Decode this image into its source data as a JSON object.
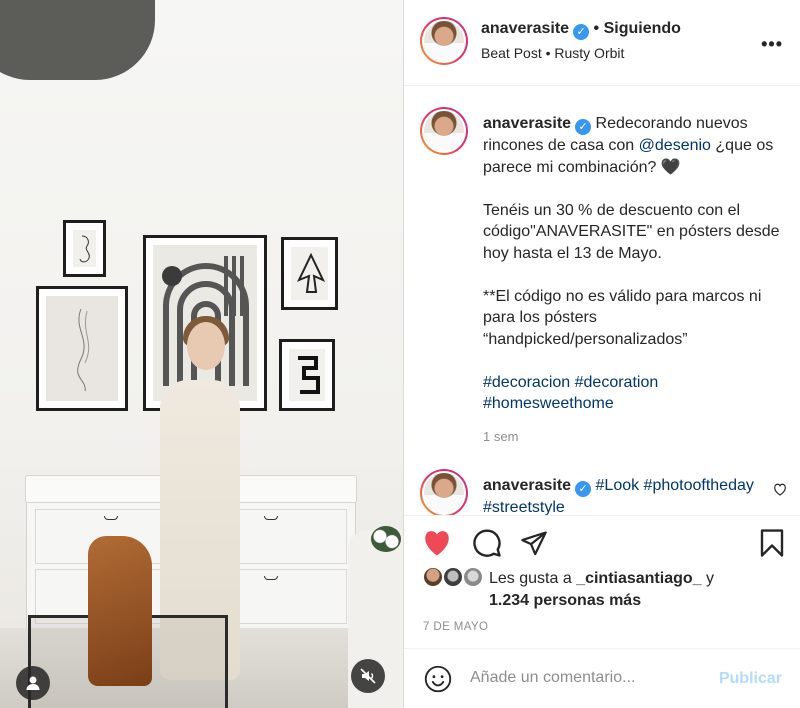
{
  "header": {
    "username": "anaverasite",
    "separator": "•",
    "follow_status": "Siguiendo",
    "audio_line": "Beat Post • Rusty Orbit",
    "more_icon": "more-horizontal-icon"
  },
  "caption": {
    "username": "anaverasite",
    "line1_pre": "Redecorando nuevos rincones de casa con ",
    "mention": "@desenio",
    "line1_post": " ¿que os parece mi combinación? 🖤",
    "para2": "Tenéis un 30 % de descuento con el código\"ANAVERASITE\" en pósters desde hoy hasta el 13 de Mayo.",
    "para3": "**El código no es válido para marcos ni para los pósters “handpicked/personalizados”",
    "hashtags": "#decoracion #decoration #homesweethome",
    "time": "1 sem"
  },
  "comment2": {
    "username": "anaverasite",
    "text": "#Look #photooftheday #streetstyle"
  },
  "actions": {
    "like_icon": "heart-filled-icon",
    "comment_icon": "comment-icon",
    "share_icon": "paper-plane-icon",
    "save_icon": "bookmark-icon",
    "likes_prefix": "Les gusta a ",
    "likes_user": "_cintiasantiago_",
    "likes_and": " y",
    "likes_count": "1.234 personas más",
    "date": "7 DE MAYO"
  },
  "comment_box": {
    "emoji_icon": "smiley-icon",
    "placeholder": "Añade un comentario...",
    "post_label": "Publicar"
  },
  "media": {
    "user_tag_icon": "user-tag-icon",
    "mute_icon": "speaker-muted-icon"
  },
  "colors": {
    "like_red": "#ed4956",
    "link_blue": "#00376b",
    "verified_blue": "#3897f0",
    "post_disabled": "#b3dbff"
  }
}
